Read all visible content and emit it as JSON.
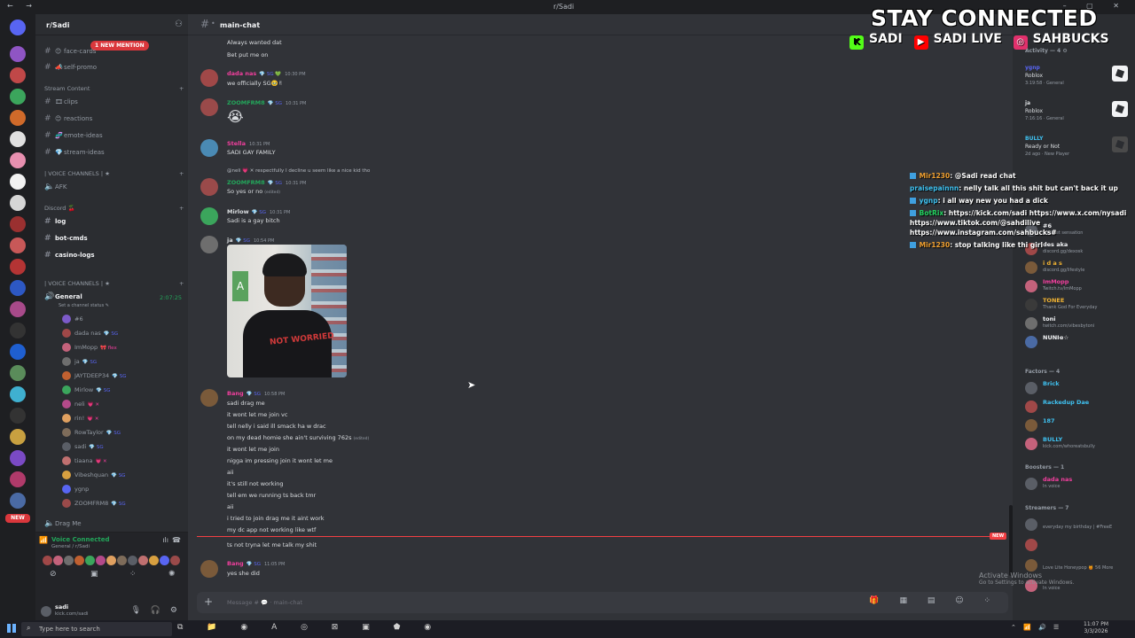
{
  "window": {
    "title": "r/Sadi",
    "nav": "← →",
    "controls": "– ▢ ✕"
  },
  "server": {
    "name": "r/Sadi",
    "mention_pill": "1 NEW MENTION",
    "new_badge": "NEW"
  },
  "channels": {
    "top_items": [
      {
        "emoji": "😊",
        "label": "face-cards"
      },
      {
        "emoji": "📣",
        "label": "self-promo"
      }
    ],
    "stream_category": "Stream Content",
    "stream_items": [
      {
        "emoji": "🎞",
        "label": "clips"
      },
      {
        "emoji": "😊",
        "label": "reactions"
      },
      {
        "emoji": "🧬",
        "label": "emote-ideas"
      },
      {
        "emoji": "💎",
        "label": "stream-ideas"
      }
    ],
    "voice_category_1": "| VOICE CHANNELS | ★",
    "afk": "AFK",
    "discord_category": "Discord 🍒",
    "discord_items": [
      "log",
      "bot-cmds",
      "casino-logs"
    ],
    "voice_category_2": "| VOICE CHANNELS | ★",
    "general": {
      "label": "General",
      "status": "Set a channel status ✎",
      "timer": "2:07:25"
    },
    "voice_users": [
      {
        "name": "#6",
        "badge": "",
        "color": "#7c5ac9"
      },
      {
        "name": "dada nas",
        "badge": "💎 SG",
        "color": "#a04848"
      },
      {
        "name": "ImMopp",
        "badge": "🎀 flex",
        "color": "#c4627b"
      },
      {
        "name": "ja",
        "badge": "💎 SG",
        "color": "#6e6e6e"
      },
      {
        "name": "JAYTDEEP34",
        "badge": "💎 SG",
        "color": "#c06030"
      },
      {
        "name": "Mirlow",
        "badge": "💎 SG",
        "color": "#3ba55c"
      },
      {
        "name": "neli",
        "badge": "💗 ✕",
        "color": "#b44a8a"
      },
      {
        "name": "rin!",
        "badge": "💗 ✕",
        "color": "#e0a060"
      },
      {
        "name": "RowTaylor",
        "badge": "💎 SG",
        "color": "#7e6c5a"
      },
      {
        "name": "sadi",
        "badge": "💎 SG",
        "color": "#5a5e66"
      },
      {
        "name": "tiaana",
        "badge": "💗 ✕",
        "color": "#c07070"
      },
      {
        "name": "Vibeshquan",
        "badge": "💎 SG",
        "color": "#d8a040"
      },
      {
        "name": "ygnp",
        "badge": "",
        "color": "#5865f2"
      },
      {
        "name": "ZOOMFRM8",
        "badge": "💎 SG",
        "color": "#9a4a4a"
      }
    ],
    "drag_me": "Drag Me"
  },
  "voice_panel": {
    "title": "Voice Connected",
    "subtitle": "General / r/Sadi"
  },
  "user_panel": {
    "name": "sadi",
    "status": "kick.com/sadi"
  },
  "chat": {
    "channel": "main-chat",
    "composer_placeholder": "Message # 💬 · main-chat",
    "new_tag": "NEW",
    "messages": [
      {
        "lines": [
          "Always wanted dat",
          "Bet put me on"
        ]
      },
      {
        "user": "dada nas",
        "badge": "💎 SG 💚",
        "time": "10:30 PM",
        "color": "#f23f9e",
        "lines": [
          "we officially SG🥹✌"
        ]
      },
      {
        "user": "ZOOMFRM8",
        "badge": "💎 SG",
        "time": "10:31 PM",
        "color": "#23a55a",
        "emoji": "😭"
      },
      {
        "user": "Stella",
        "badge": "",
        "time": "10:31 PM",
        "color": "#f23f9e",
        "lines": [
          "SADI GAY FAMILY"
        ]
      },
      {
        "reply": "@neli 💗 ✕ respectfully I decline u seem like a nice kid tho",
        "user": "ZOOMFRM8",
        "badge": "💎 SG",
        "time": "10:31 PM",
        "color": "#23a55a",
        "lines": [
          "So yes or no"
        ],
        "edited": "(edited)"
      },
      {
        "user": "Mirlow",
        "badge": "💎 SG",
        "time": "10:31 PM",
        "color": "#dbdee1",
        "lines": [
          "Sadi is a gay bitch"
        ]
      },
      {
        "user": "ja",
        "badge": "💎 SG",
        "time": "10:54 PM",
        "color": "#dbdee1",
        "image_text": "NOT WORRIED",
        "image_sign": "A"
      },
      {
        "user": "Bang",
        "badge": "💎 SG",
        "time": "10:58 PM",
        "color": "#f23f9e",
        "lines": [
          "sadi drag me",
          "it wont let me join vc",
          "tell nelly i said ill smack ha w drac",
          "on my dead homie she ain't surviving 762s",
          "it wont let me join",
          "nigga im pressing join it wont let me",
          "aii",
          "it's still not working",
          "tell em we running ts back tmr",
          "aii",
          "i tried to join drag me it aint work",
          "my dc app not working like wtf"
        ],
        "edited": "(edited)"
      },
      {
        "lines": [
          "ts not tryna let me talk my shit"
        ]
      },
      {
        "user": "Bang",
        "badge": "💎 SG",
        "time": "11:05 PM",
        "color": "#f23f9e",
        "lines": [
          "yes she did"
        ]
      }
    ]
  },
  "overlay": {
    "title": "STAY CONNECTED",
    "socials": [
      {
        "label": "SADI",
        "icon": "K",
        "color": "#53fc18"
      },
      {
        "label": "SADI LIVE",
        "icon": "▶",
        "color": "#ff0000"
      },
      {
        "label": "SAHBUCKS",
        "icon": "◎",
        "color": "#e1306c"
      }
    ]
  },
  "stream_chat": [
    {
      "user": "Mir1230",
      "text": ": @Sadi read chat",
      "cls": "u"
    },
    {
      "user": "praisepainnn",
      "text": ": nelly talk all this shit but can't back it up",
      "cls": "u2"
    },
    {
      "user": "ygnp",
      "text": ": i all way new you had a dick",
      "cls": "u2"
    },
    {
      "user": "BotRix",
      "text": ": https://kick.com/sadi https://www.x.com/nysadi",
      "cls": "u3",
      "extra": [
        "https://www.tiktok.com/@sahdilive",
        "https://www.instagram.com/sahbucks#"
      ]
    },
    {
      "user": "Mir1230",
      "text": ": stop talking like thi girl",
      "cls": "u"
    }
  ],
  "members": {
    "activity_header": "Activity — 4 ⚙",
    "activities": [
      {
        "name": "ygnp",
        "game": "Roblox",
        "detail": "3:19:58 · General"
      },
      {
        "name": "ja",
        "game": "Roblox",
        "detail": "7:16:16 · General"
      },
      {
        "name": "BULLY",
        "game": "Ready or Not",
        "detail": "2d ago · New Player"
      }
    ],
    "top": [
      {
        "name": "#6",
        "status": "internet sensation",
        "color": "#f2f3f5"
      },
      {
        "name": "des aka",
        "status": "discord.gg/dexosk",
        "color": "#f2f3f5"
      },
      {
        "name": "i d a s",
        "status": "discord.gg/lifestyle",
        "color": "#f0b232"
      },
      {
        "name": "ImMopp",
        "status": "Twitch.tv/ImMopp",
        "color": "#f23f9e"
      },
      {
        "name": "TONEE",
        "status": "Thank God For Everyday",
        "color": "#f0b232"
      },
      {
        "name": "toni",
        "status": "twitch.com/vibesbytoni",
        "color": "#f2f3f5"
      },
      {
        "name": "NUNIɞ☆",
        "status": "",
        "color": "#f2f3f5"
      }
    ],
    "factors_header": "Factors — 4",
    "factors": [
      {
        "name": "Brick",
        "status": "",
        "color": "#3fc1f0"
      },
      {
        "name": "Rackedup Dae",
        "status": "",
        "color": "#3fc1f0"
      },
      {
        "name": "187",
        "status": "",
        "color": "#3fc1f0"
      },
      {
        "name": "BULLY",
        "status": "kick.com/whoreatsbully",
        "color": "#3fc1f0"
      }
    ],
    "boosters_header": "Boosters — 1",
    "boosters": [
      {
        "name": "dada nas",
        "status": "In voice",
        "color": "#f23f9e"
      }
    ],
    "streamers_header": "Streamers — 7",
    "streamers": [
      {
        "name": "",
        "status": "everyday my birthday | #FreeE",
        "color": "#b14ad6"
      },
      {
        "name": "",
        "status": "",
        "color": "#b14ad6"
      },
      {
        "name": "",
        "status": "Love Lite Honeypop 🍯 56 More",
        "color": "#b14ad6"
      },
      {
        "name": "",
        "status": "In voice",
        "color": "#b14ad6"
      }
    ]
  },
  "watermark": {
    "title": "Activate Windows",
    "sub": "Go to Settings to activate Windows."
  },
  "taskbar": {
    "search": "Type here to search",
    "time": "11:07 PM",
    "date": "3/3/2026"
  }
}
